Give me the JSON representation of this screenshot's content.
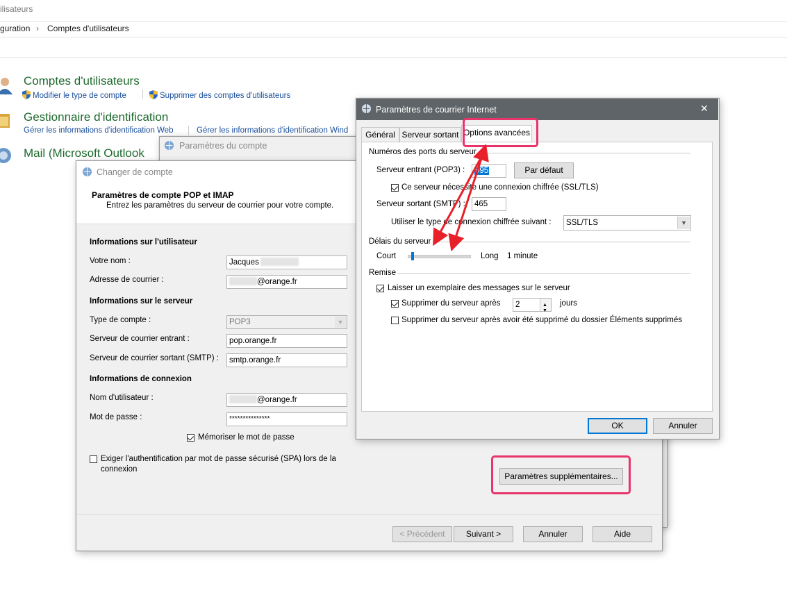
{
  "window": {
    "title_fragment": "ilisateurs"
  },
  "breadcrumb": {
    "part1": "guration",
    "separator": "›",
    "part2": "Comptes d'utilisateurs"
  },
  "control_panel": {
    "user_accounts": {
      "title": "Comptes d'utilisateurs",
      "link1": "Modifier le type de compte",
      "link2": "Supprimer des comptes d'utilisateurs"
    },
    "credential_manager": {
      "title": "Gestionnaire d'identification",
      "link1": "Gérer les informations d'identification Web",
      "link2": "Gérer les informations d'identification Wind"
    },
    "mail": {
      "title": "Mail (Microsoft Outlook"
    }
  },
  "account_settings": {
    "title": "Paramètres du compte"
  },
  "change_account": {
    "title": "Changer de compte",
    "heading": "Paramètres de compte POP et IMAP",
    "subheading": "Entrez les paramètres du serveur de courrier pour votre compte.",
    "user_info_header": "Informations sur l'utilisateur",
    "name_label": "Votre nom :",
    "name_value": "Jacques",
    "email_label": "Adresse de courrier :",
    "email_value": "@orange.fr",
    "server_info_header": "Informations sur le serveur",
    "account_type_label": "Type de compte :",
    "account_type_value": "POP3",
    "incoming_label": "Serveur de courrier entrant :",
    "incoming_value": "pop.orange.fr",
    "outgoing_label": "Serveur de courrier sortant (SMTP) :",
    "outgoing_value": "smtp.orange.fr",
    "logon_header": "Informations de connexion",
    "username_label": "Nom d'utilisateur :",
    "username_value": "@orange.fr",
    "password_label": "Mot de passe :",
    "password_value": "***************",
    "remember_label": "Mémoriser le mot de passe",
    "spa_label_line1": "Exiger l'authentification par mot de passe sécurisé (SPA) lors de la",
    "spa_label_line2": "connexion",
    "more_settings_button": "Paramètres supplémentaires...",
    "back_button": "< Précédent",
    "next_button": "Suivant >",
    "cancel_button": "Annuler",
    "help_button": "Aide"
  },
  "internet_settings": {
    "title": "Paramètres de courrier Internet",
    "close_glyph": "✕",
    "tabs": [
      {
        "label": "Général"
      },
      {
        "label": "Serveur sortant"
      },
      {
        "label": "Options avancées"
      }
    ],
    "ports_header": "Numéros des ports du serveur",
    "incoming_label": "Serveur entrant (POP3) :",
    "incoming_port": "995",
    "default_button": "Par défaut",
    "ssl_required_label": "Ce serveur nécessite une connexion chiffrée (SSL/TLS)",
    "outgoing_label": "Serveur sortant (SMTP) :",
    "outgoing_port": "465",
    "encryption_label": "Utiliser le type de connexion chiffrée suivant :",
    "encryption_value": "SSL/TLS",
    "timeout_header": "Délais du serveur",
    "timeout_short": "Court",
    "timeout_long": "Long",
    "timeout_value": "1 minute",
    "timeout_level": 0.05,
    "delivery_header": "Remise",
    "leave_copy_label": "Laisser un exemplaire des messages sur le serveur",
    "remove_after_label": "Supprimer du serveur après",
    "remove_after_days": "2",
    "days_unit": "jours",
    "remove_deleted_label": "Supprimer du serveur après avoir été supprimé du dossier Éléments supprimés",
    "ok_button": "OK",
    "cancel_button": "Annuler"
  },
  "colors": {
    "highlight": "#e8336b",
    "arrow": "#e8202a",
    "accent": "#0078d7",
    "cp_title": "#1e6a2e",
    "cp_link": "#1a4f9c"
  }
}
